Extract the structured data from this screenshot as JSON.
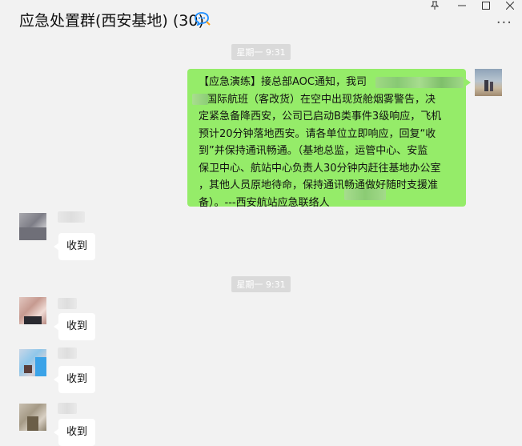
{
  "header": {
    "title": "应急处置群(西安基地) (30)"
  },
  "time_separators": [
    "星期一 9:31",
    "星期一 9:31"
  ],
  "messages": {
    "outgoing": {
      "line1": "【应急演练】接总部AOC通知，我司",
      "line2": "国际航班（客改货）在空中出现货舱烟雾警告，决",
      "line3": "定紧急备降西安，公司已启动B类事件3级响应，飞机",
      "line4": "预计20分钟落地西安。请各单位立即响应，回复“收",
      "line5": "到”并保持通讯畅通。（基地总监，运管中心、安监",
      "line6": "保卫中心、航站中心负责人30分钟内赶往基地办公室",
      "line7": "，其他人员原地待命，保持通讯畅通做好随时支援准",
      "line8": "备）。---西安航站应急联络人"
    },
    "replies": [
      "收到",
      "收到",
      "收到",
      "收到"
    ]
  },
  "colors": {
    "own_bubble": "#95ec69",
    "other_bubble": "#ffffff",
    "background": "#f2f2f2",
    "title_icon": "#1a8cff"
  }
}
